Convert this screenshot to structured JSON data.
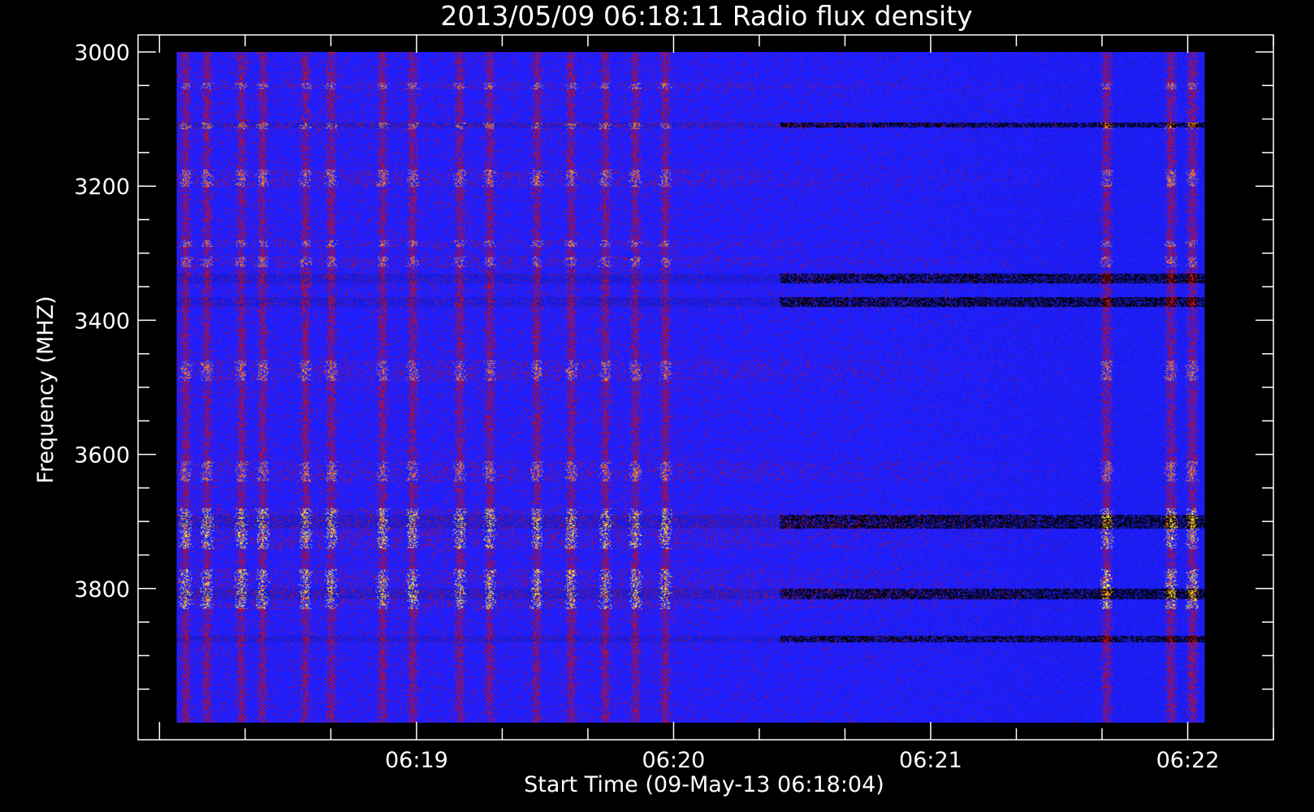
{
  "chart_data": {
    "type": "heatmap",
    "title": "2013/05/09 06:18:11 Radio flux density",
    "xlabel": "Start Time (09-May-13 06:18:04)",
    "ylabel": "Frequency (MHZ)",
    "xlim": [
      "06:17:55",
      "06:22:20"
    ],
    "ylim": [
      3000,
      4000
    ],
    "y_inverted": true,
    "x_ticks": [
      "06:19",
      "06:20",
      "06:21",
      "06:22"
    ],
    "y_ticks": [
      3000,
      3200,
      3400,
      3600,
      3800
    ],
    "data_range": {
      "t_start": "06:18:04",
      "t_end": "06:22:04",
      "f_start": 3000,
      "f_end": 4000
    },
    "colormap": [
      "#000000",
      "#1a1ad0",
      "#1e1eff",
      "#c01020",
      "#ff3010",
      "#ff9020",
      "#ffff40"
    ],
    "burst_columns": [
      "06:18:06",
      "06:18:11",
      "06:18:19",
      "06:18:24",
      "06:18:34",
      "06:18:40",
      "06:18:52",
      "06:18:59",
      "06:19:10",
      "06:19:17",
      "06:19:28",
      "06:19:36",
      "06:19:44",
      "06:19:51",
      "06:19:58",
      "06:21:41",
      "06:21:56",
      "06:22:01"
    ],
    "emission_bands_mhz": [
      [
        3045,
        3055
      ],
      [
        3105,
        3115
      ],
      [
        3175,
        3200
      ],
      [
        3280,
        3290
      ],
      [
        3305,
        3320
      ],
      [
        3460,
        3490
      ],
      [
        3610,
        3640
      ],
      [
        3680,
        3740
      ],
      [
        3770,
        3830
      ]
    ],
    "dark_bands_mhz": [
      [
        3105,
        3112
      ],
      [
        3330,
        3345
      ],
      [
        3365,
        3380
      ],
      [
        3690,
        3710
      ],
      [
        3800,
        3815
      ],
      [
        3870,
        3880
      ]
    ],
    "grid": false,
    "legend": "none"
  }
}
